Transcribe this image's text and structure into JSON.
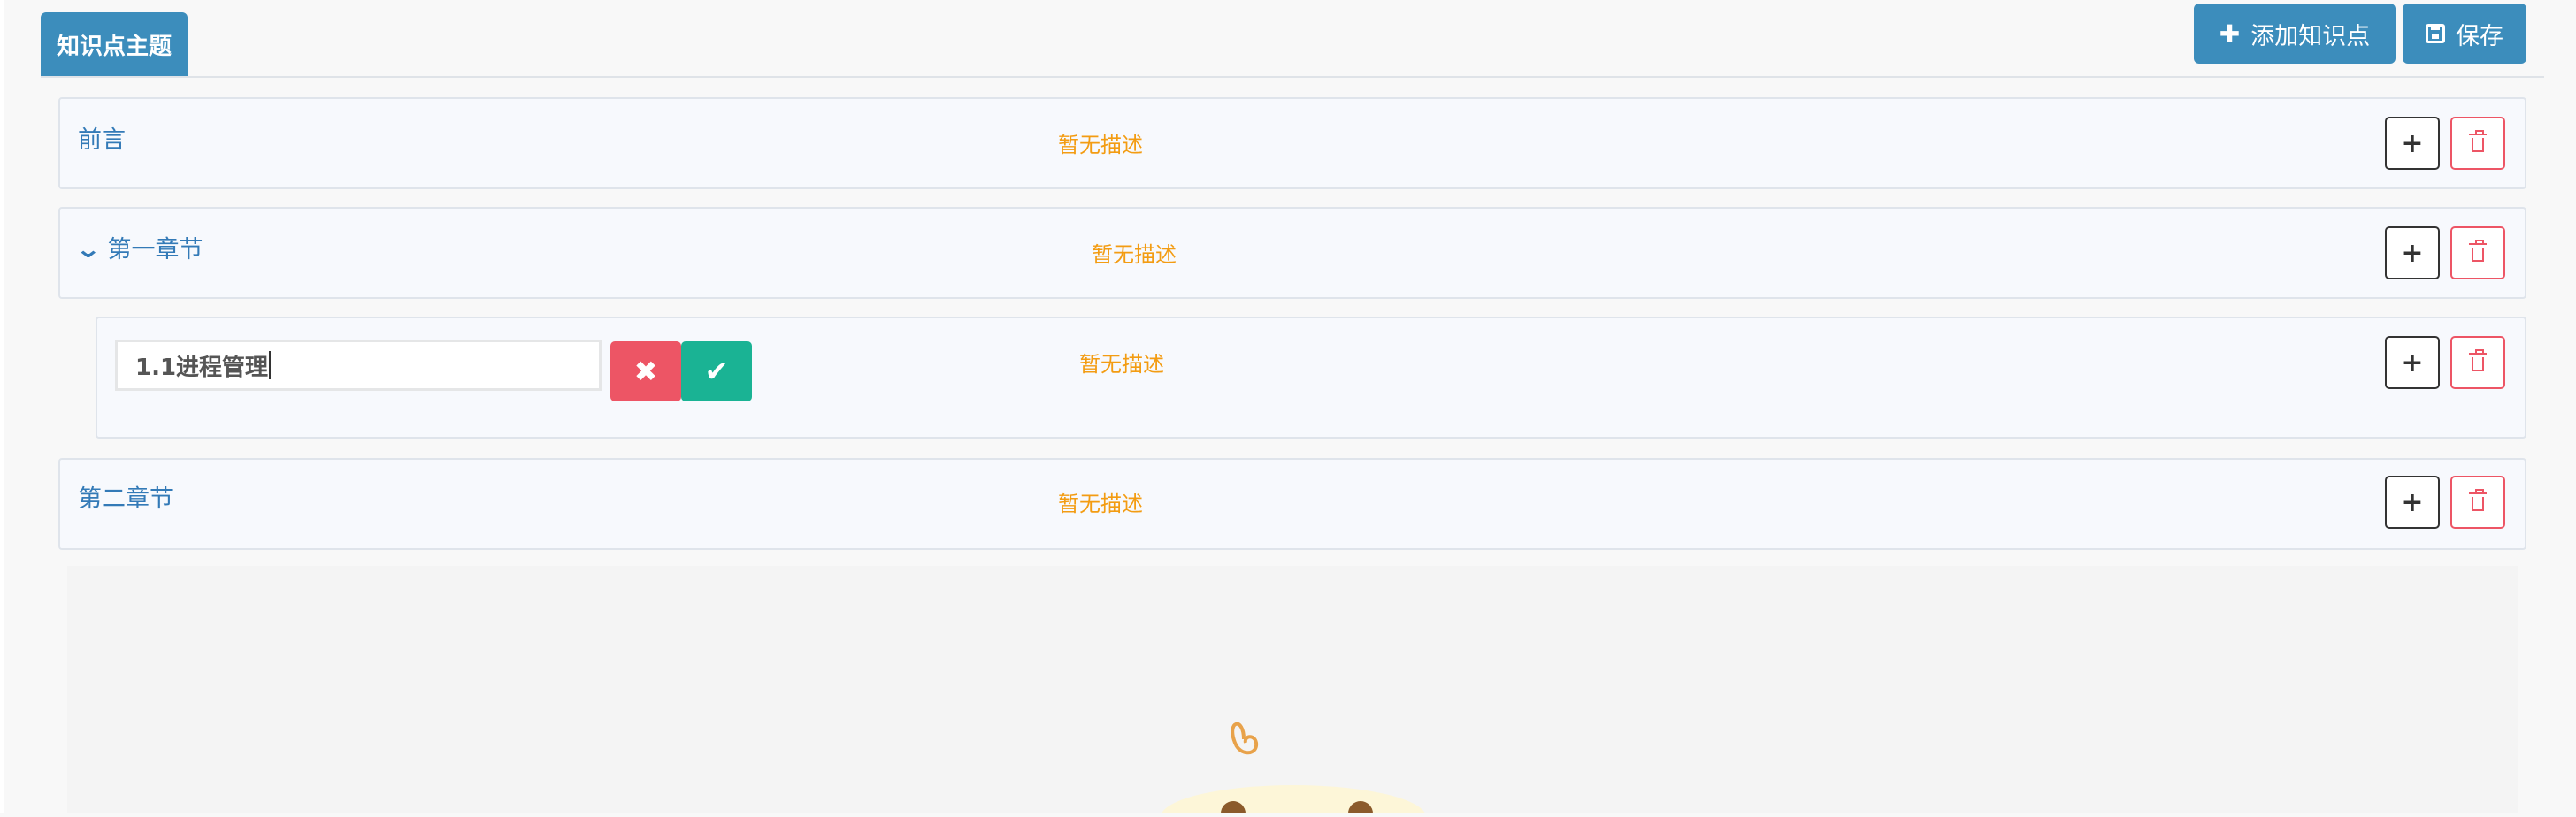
{
  "header": {
    "tab_title": "知识点主题",
    "add_button_label": "添加知识点",
    "save_button_label": "保存"
  },
  "rows": [
    {
      "title": "前言",
      "description": "暂无描述"
    },
    {
      "title": "第一章节",
      "description": "暂无描述",
      "expanded": true
    },
    {
      "title": "1.1进程管理",
      "description": "暂无描述",
      "editing": true
    },
    {
      "title": "第二章节",
      "description": "暂无描述"
    }
  ],
  "edit": {
    "input_value": "1.1进程管理"
  },
  "icons": {
    "add": "plus-icon",
    "delete": "trash-icon",
    "expand": "chevron-down-icon",
    "cancel": "close-icon",
    "confirm": "check-icon",
    "save": "floppy-disk-icon"
  },
  "colors": {
    "primary": "#3c8dbc",
    "link": "#337ab7",
    "description": "#f39c12",
    "danger": "#ed5565",
    "success": "#1ab394"
  }
}
